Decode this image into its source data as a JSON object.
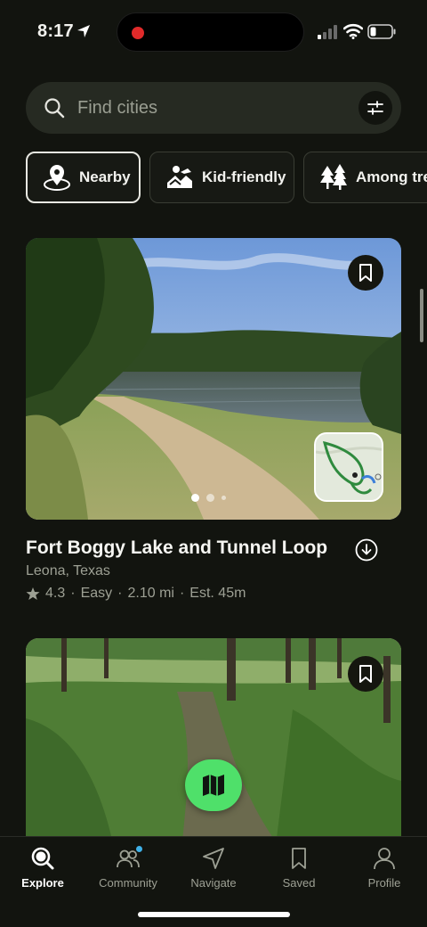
{
  "status_bar": {
    "time": "8:17"
  },
  "search": {
    "placeholder": "Find cities"
  },
  "chips": [
    {
      "label": "Nearby",
      "icon": "location-pin-icon",
      "active": true
    },
    {
      "label": "Kid-friendly",
      "icon": "kid-friendly-icon",
      "active": false
    },
    {
      "label": "Among trees",
      "icon": "trees-icon",
      "active": false
    }
  ],
  "trails": [
    {
      "title": "Fort Boggy Lake and Tunnel Loop",
      "location": "Leona, Texas",
      "rating": "4.3",
      "difficulty": "Easy",
      "distance": "2.10 mi",
      "est": "Est. 45m",
      "photo_index": 1,
      "photo_count": 3
    },
    {}
  ],
  "nav": [
    {
      "label": "Explore",
      "icon": "explore-search-icon",
      "active": true
    },
    {
      "label": "Community",
      "icon": "community-icon",
      "active": false
    },
    {
      "label": "Navigate",
      "icon": "navigate-arrow-icon",
      "active": false
    },
    {
      "label": "Saved",
      "icon": "bookmark-icon",
      "active": false
    },
    {
      "label": "Profile",
      "icon": "profile-icon",
      "active": false
    }
  ],
  "colors": {
    "background": "#12140f",
    "accent_green": "#4fe06a",
    "badge_blue": "#3fb1e8"
  }
}
